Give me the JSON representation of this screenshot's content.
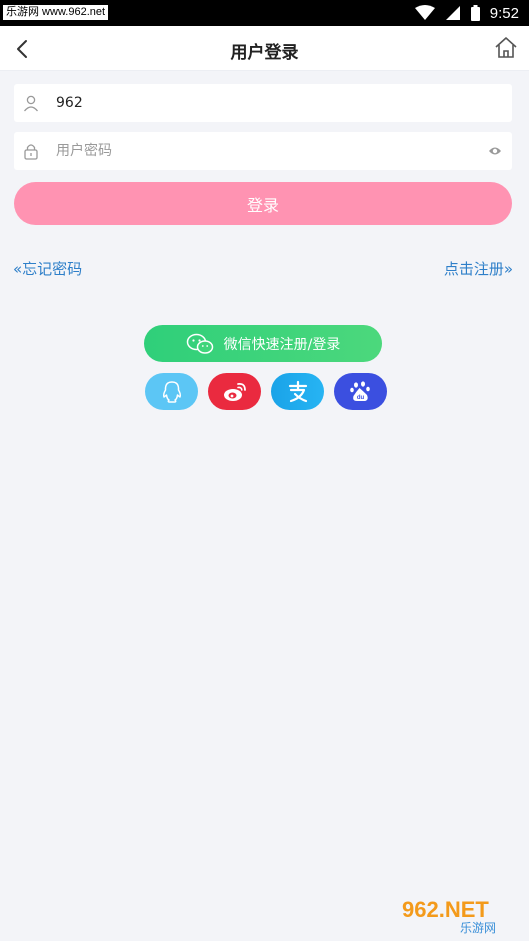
{
  "status_bar": {
    "watermark_text": "乐游网 www.962.net",
    "time": "9:52"
  },
  "nav": {
    "title": "用户登录"
  },
  "form": {
    "username_value": "962",
    "password_placeholder": "用户密码",
    "login_label": "登录",
    "forgot_label": "«忘记密码",
    "register_label": "点击注册»"
  },
  "social": {
    "wechat_label": "微信快速注册/登录",
    "providers": [
      "qq",
      "weibo",
      "alipay",
      "baidu"
    ]
  },
  "watermark": {
    "brand": "962.NET",
    "brand_sub": "乐游网"
  },
  "colors": {
    "login_button": "#ff93b2",
    "link": "#2e7fc9",
    "wechat": "#2fcf7a",
    "qq": "#5cc6f5",
    "weibo": "#ea2a3f",
    "alipay": "#1aa3e8",
    "baidu": "#3b4fe0"
  }
}
